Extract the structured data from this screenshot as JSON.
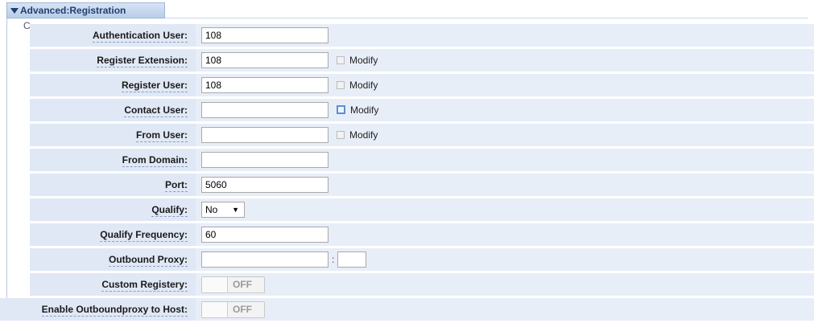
{
  "section": {
    "title": "Advanced:Registration",
    "frame_glyph": "C"
  },
  "rows": {
    "auth_user": {
      "label": "Authentication User:",
      "value": "108"
    },
    "reg_ext": {
      "label": "Register Extension:",
      "value": "108",
      "modify": "Modify"
    },
    "reg_user": {
      "label": "Register User:",
      "value": "108",
      "modify": "Modify"
    },
    "contact_user": {
      "label": "Contact User:",
      "value": "",
      "modify": "Modify"
    },
    "from_user": {
      "label": "From User:",
      "value": "",
      "modify": "Modify"
    },
    "from_domain": {
      "label": "From Domain:",
      "value": ""
    },
    "port": {
      "label": "Port:",
      "value": "5060"
    },
    "qualify": {
      "label": "Qualify:",
      "value": "No"
    },
    "qualify_freq": {
      "label": "Qualify Frequency:",
      "value": "60"
    },
    "outbound_proxy": {
      "label": "Outbound Proxy:",
      "value": "",
      "separator": ":"
    },
    "custom_registery": {
      "label": "Custom Registery:",
      "state": "OFF"
    },
    "outboundproxy_host": {
      "label": "Enable Outboundproxy to Host:",
      "state": "OFF"
    }
  }
}
